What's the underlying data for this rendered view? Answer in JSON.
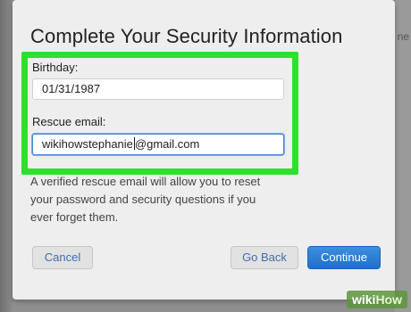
{
  "background": {
    "edge_text": "ne"
  },
  "dialog": {
    "title": "Complete Your Security Information",
    "birthday": {
      "label": "Birthday:",
      "value": "01/31/1987"
    },
    "rescue_email": {
      "label": "Rescue email:",
      "value_before_caret": "wikihowstephanie",
      "value_after_caret": "@gmail.com"
    },
    "help_text": "A verified rescue email will allow you to reset your password and security questions if you ever forget them.",
    "buttons": {
      "cancel": "Cancel",
      "go_back": "Go Back",
      "continue": "Continue"
    }
  },
  "watermark": {
    "part1": "wiki",
    "part2": "How"
  },
  "colors": {
    "highlight": "#2ee02e",
    "primary": "#2a7ad6",
    "link": "#3a6fb0"
  }
}
